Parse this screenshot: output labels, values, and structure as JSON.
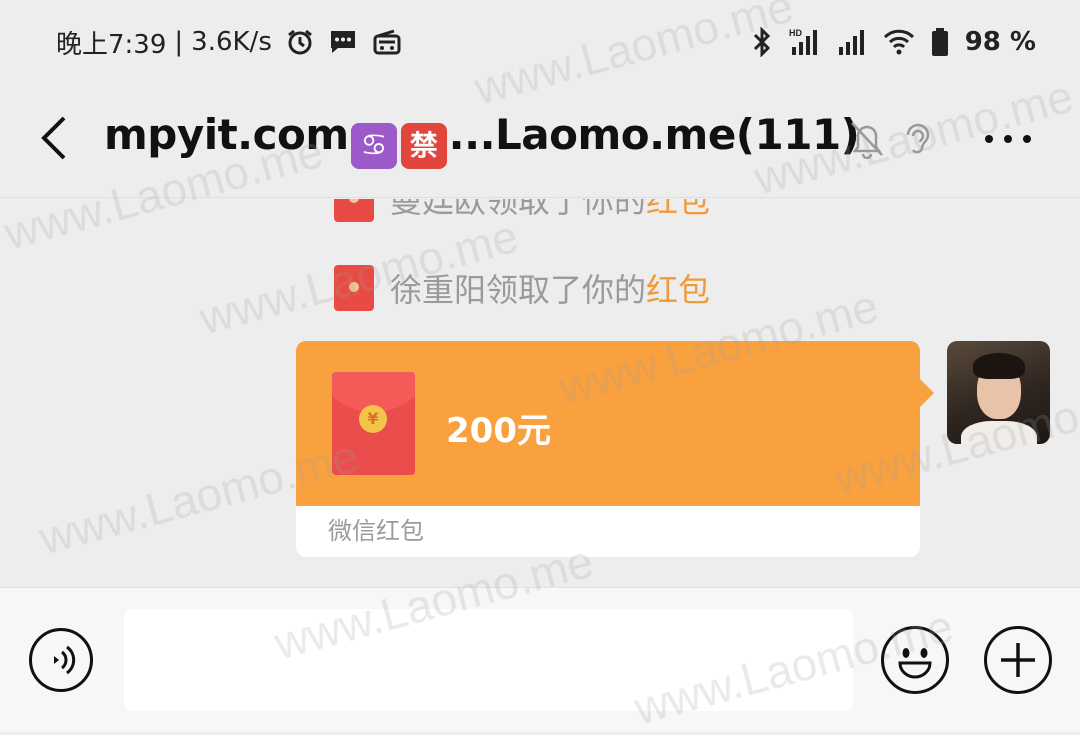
{
  "status_bar": {
    "time_label": "晚上7:39",
    "separator": "|",
    "net_speed": "3.6K/s",
    "battery_percent": "98 %",
    "icons": [
      "alarm-icon",
      "message-icon",
      "radio-icon",
      "bluetooth-icon",
      "hd-signal-icon",
      "signal-icon",
      "wifi-icon",
      "battery-icon"
    ]
  },
  "header": {
    "title_prefix": "mpyit.com",
    "emoji_cancer": "♋",
    "emoji_ban": "禁",
    "title_suffix": "...Laomo.me(111)",
    "icons": [
      "back-icon",
      "mute-bell-icon",
      "ear-icon",
      "more-icon"
    ]
  },
  "messages": {
    "notice_partial": {
      "name": "曼廷欧领取了你的",
      "highlight": "红包"
    },
    "notice": {
      "name": "徐重阳领取了你的",
      "highlight": "红包"
    },
    "red_packet": {
      "currency_symbol": "¥",
      "amount": "200元",
      "footer": "微信红包"
    }
  },
  "input_bar": {
    "input_value": "",
    "icons": [
      "voice-icon",
      "emoji-icon",
      "plus-icon"
    ]
  },
  "watermark_text": "www.Laomo.me",
  "colors": {
    "background": "#ededed",
    "red_packet_orange": "#f9a03f",
    "envelope_red": "#ea4d4b",
    "highlight": "#f09a3a"
  }
}
